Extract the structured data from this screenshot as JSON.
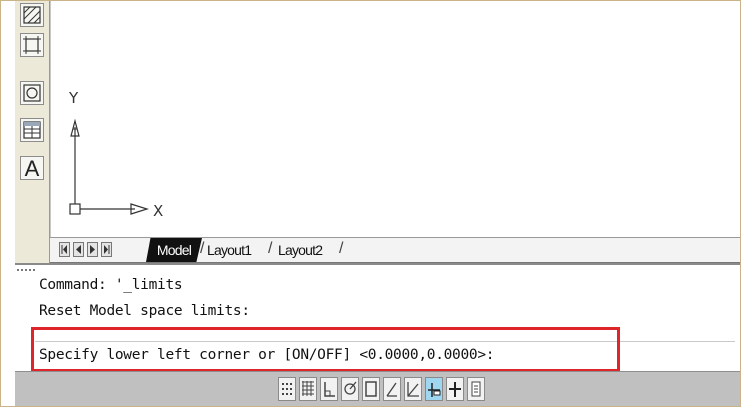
{
  "toolbar": {
    "icons": [
      "hatch-icon",
      "boundary-icon",
      "region-icon",
      "table-icon",
      "multiline-text-icon"
    ],
    "text_tool_glyph": "A"
  },
  "canvas": {
    "ucs": {
      "y_label": "Y",
      "x_label": "X"
    }
  },
  "tabs": {
    "items": [
      {
        "label": "Model",
        "active": true
      },
      {
        "label": "Layout1",
        "active": false
      },
      {
        "label": "Layout2",
        "active": false
      }
    ],
    "nav_buttons": [
      "first-tab-icon",
      "previous-tab-icon",
      "next-tab-icon",
      "last-tab-icon"
    ]
  },
  "command_line": {
    "history": [
      "Command: '_limits",
      "Reset Model space limits:"
    ],
    "prompt": "Specify lower left corner or [ON/OFF] <0.0000,0.0000>:",
    "highlight_color": "#e0252a"
  },
  "status_bar": {
    "toggles": [
      {
        "name": "snap-mode-icon",
        "on": false
      },
      {
        "name": "grid-display-icon",
        "on": false
      },
      {
        "name": "ortho-mode-icon",
        "on": false
      },
      {
        "name": "polar-tracking-icon",
        "on": false
      },
      {
        "name": "object-snap-icon",
        "on": false
      },
      {
        "name": "object-snap-tracking-icon",
        "on": false
      },
      {
        "name": "dynamic-ucs-icon",
        "on": false
      },
      {
        "name": "dynamic-input-icon",
        "on": true
      },
      {
        "name": "lineweight-icon",
        "on": false
      },
      {
        "name": "quick-properties-icon",
        "on": false
      }
    ],
    "active_color": "#9ed7ef"
  }
}
